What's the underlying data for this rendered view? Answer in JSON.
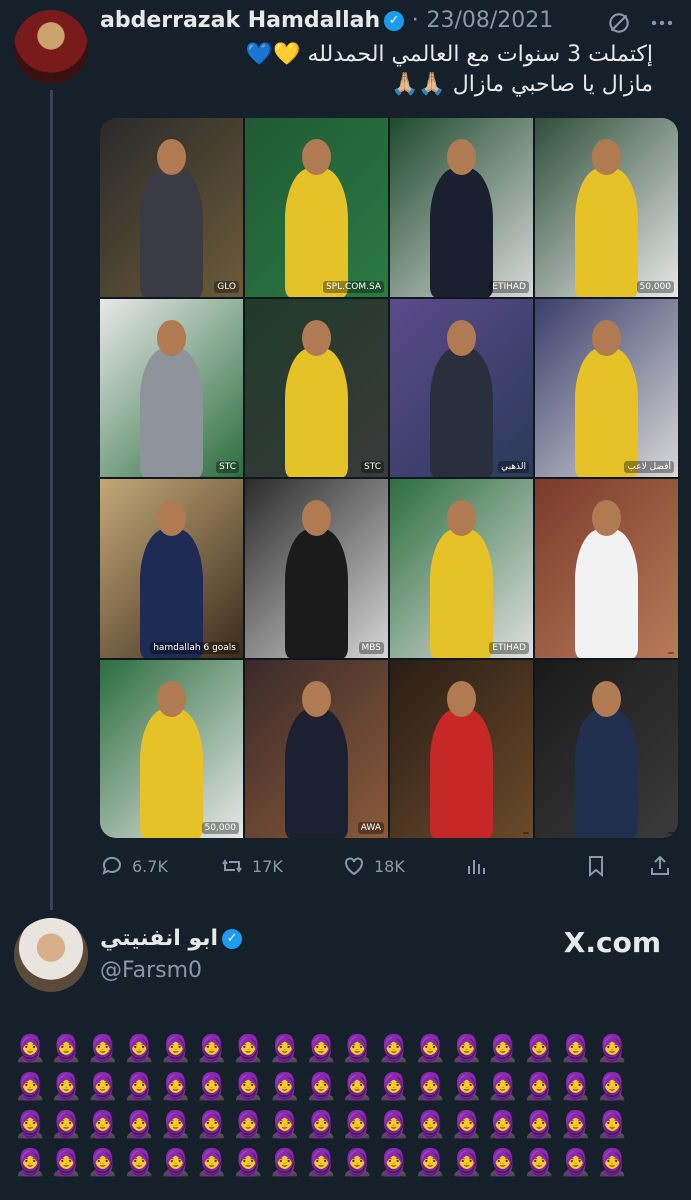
{
  "tweet": {
    "author_name": "abderrazak Hamdallah",
    "separator": "·",
    "date": "23/08/2021",
    "line1": "إكتملت 3 سنوات مع العالمي الحمدلله 💛💙",
    "line2": "مازال يا صاحبي مازال 🙏🏼🙏🏼",
    "photo_captions": [
      "GLO",
      "SPL.COM.SA",
      "ETIHAD",
      "50,000",
      "STC",
      "STC",
      "الذهبي",
      "أفضل لاعب",
      "hamdallah 6 goals",
      "MBS",
      "ETIHAD",
      "",
      "50,000",
      "AWA",
      "",
      ""
    ],
    "actions": {
      "replies": "6.7K",
      "retweets": "17K",
      "likes": "18K"
    }
  },
  "quote": {
    "name": "ابو انفنيتي",
    "handle": "@Farsm0",
    "watermark": "X.com"
  },
  "emoji_rows": [
    "🧕🧕🧕🧕🧕🧕🧕🧕🧕🧕🧕🧕🧕🧕🧕🧕🧕",
    "🧕🧕🧕🧕🧕🧕🧕🧕🧕🧕🧕🧕🧕🧕🧕🧕🧕",
    "🧕🧕🧕🧕🧕🧕🧕🧕🧕🧕🧕🧕🧕🧕🧕🧕🧕",
    "🧕🧕🧕🧕🧕🧕🧕🧕🧕🧕🧕🧕🧕🧕🧕🧕🧕"
  ],
  "colors": {
    "background": "#15202b",
    "accent": "#1d9bf0",
    "muted": "#8b98a5"
  }
}
